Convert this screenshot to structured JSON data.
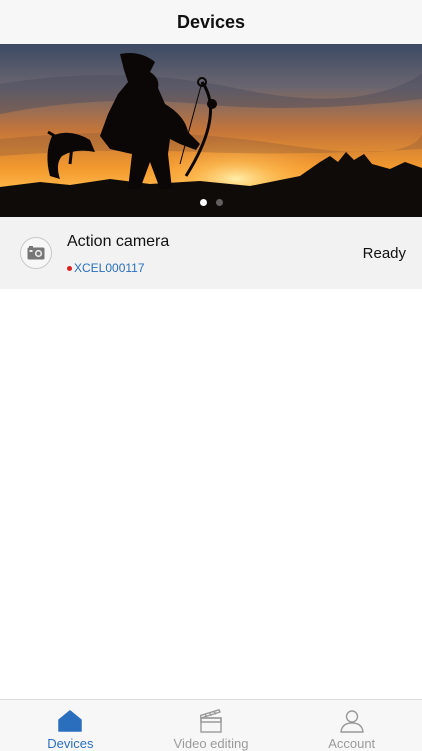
{
  "header": {
    "title": "Devices"
  },
  "banner": {
    "slides": 2,
    "active_slide": 1
  },
  "devices": [
    {
      "name": "Action camera",
      "id": "XCEL000117",
      "status": "Ready",
      "icon": "action-camera-icon",
      "connection_dot_color": "#e02020"
    }
  ],
  "tabs": [
    {
      "label": "Devices",
      "icon": "home-icon",
      "active": true
    },
    {
      "label": "Video editing",
      "icon": "clapperboard-icon",
      "active": false
    },
    {
      "label": "Account",
      "icon": "person-icon",
      "active": false
    }
  ],
  "colors": {
    "accent": "#2a6fbe",
    "inactive_tab": "#9a9a9a"
  }
}
